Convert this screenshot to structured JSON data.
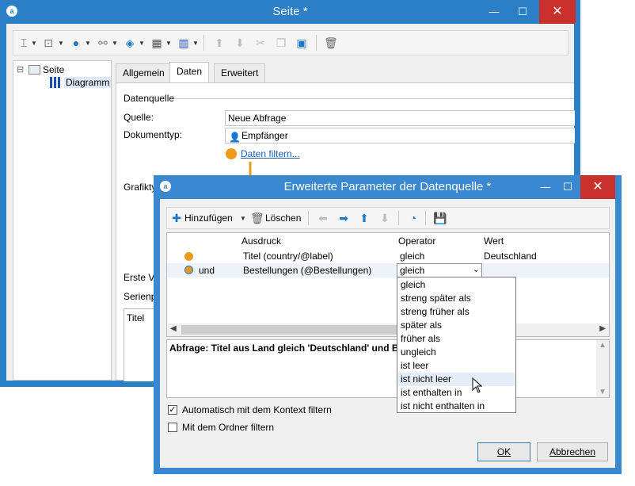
{
  "main_window": {
    "title": "Seite *",
    "controls": {
      "minimize": "—",
      "maximize": "☐",
      "close": "✕"
    },
    "tree": {
      "root_label": "Seite",
      "child_label": "Diagramm",
      "expander": "⊟"
    },
    "tabs": [
      {
        "label": "Allgemein"
      },
      {
        "label": "Daten"
      },
      {
        "label": "Erweitert"
      }
    ],
    "section_label": "Datenquelle",
    "source_label": "Quelle:",
    "source_value": "Neue Abfrage",
    "doctype_label": "Dokumenttyp:",
    "doctype_value": "Empfänger",
    "filter_link": "Daten filtern...",
    "partial_labels": {
      "grafik": "Grafikty",
      "erste": "Erste Va",
      "serien": "Serienp",
      "titel": "Titel"
    }
  },
  "dialog": {
    "title": "Erweiterte Parameter der Datenquelle *",
    "controls": {
      "minimize": "—",
      "maximize": "☐",
      "close": "✕"
    },
    "toolbar": {
      "add_label": "Hinzufügen",
      "delete_label": "Löschen"
    },
    "grid": {
      "headers": {
        "ausdruck": "Ausdruck",
        "operator": "Operator",
        "wert": "Wert"
      },
      "rows": [
        {
          "conj": "",
          "ausdruck": "Titel (country/@label)",
          "operator": "gleich",
          "wert": "Deutschland"
        },
        {
          "conj": "und",
          "ausdruck": "Bestellungen (@Bestellungen)",
          "operator": "gleich",
          "wert": ""
        }
      ]
    },
    "operator_options": [
      "gleich",
      "streng später als",
      "streng früher als",
      "später als",
      "früher als",
      "ungleich",
      "ist leer",
      "ist nicht leer",
      "ist enthalten in",
      "ist nicht enthalten in"
    ],
    "hovered_option_index": 7,
    "query_text": "Abfrage: Titel aus Land gleich 'Deutschland' und Bes",
    "checkbox_context": {
      "label": "Automatisch mit dem Kontext filtern",
      "checked": true
    },
    "checkbox_folder": {
      "label": "Mit dem Ordner filtern",
      "checked": false
    },
    "ok_label": "OK",
    "cancel_label": "Abbrechen"
  },
  "colors": {
    "titlebar": "#2b7fc6",
    "close": "#c9302c",
    "accent_orange": "#f09a1a",
    "link_blue": "#1f5fb3",
    "arrow_blue": "#1b78c8"
  }
}
